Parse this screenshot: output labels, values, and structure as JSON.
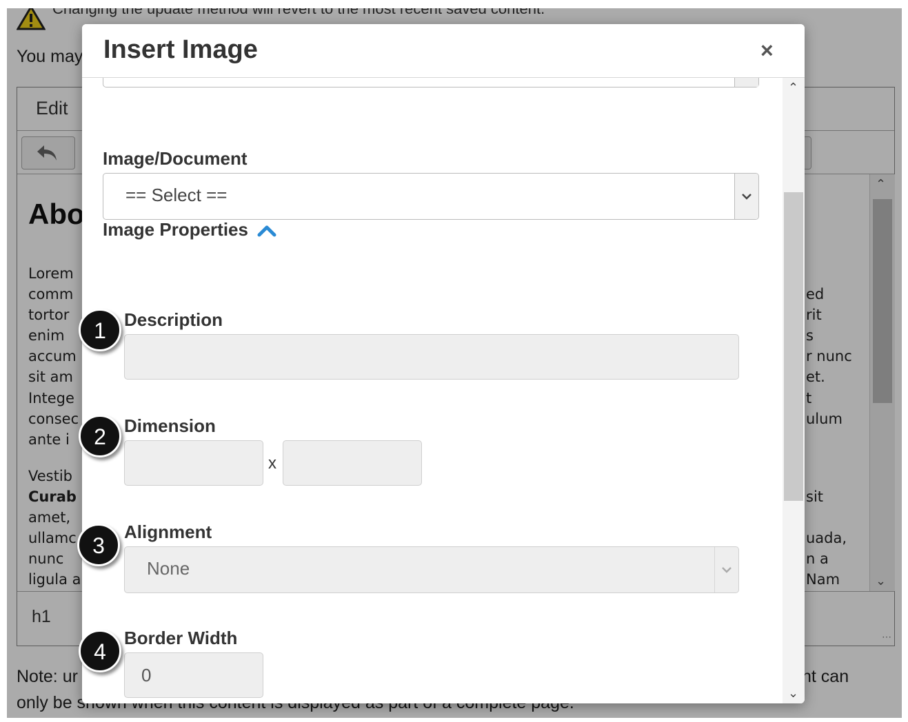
{
  "background": {
    "warning_text": "Changing the update method will revert to the most recent saved content.",
    "you_may_text": "You may",
    "edit_menu_label": "Edit",
    "content_heading": "Abo",
    "content_left_lines": [
      "Lorem",
      "comm",
      "tortor",
      "enim",
      "accum",
      "sit am",
      "Intege",
      "consec",
      "ante i",
      "",
      "Vestib",
      "Curab",
      "amet,",
      "ullamc",
      "nunc",
      "ligula a"
    ],
    "content_right_lines": [
      "ed",
      "rit",
      "s",
      "r nunc",
      "et.",
      "t",
      "ulum",
      "",
      "sit",
      "uada,",
      "n a",
      "Nam"
    ],
    "path_label": "h1",
    "note_left": "Note: ur",
    "note_right": "nt can",
    "note_line2": "only be shown when this content is displayed as part of a complete page."
  },
  "modal": {
    "title": "Insert Image",
    "close_symbol": "×",
    "image_document": {
      "label": "Image/Document",
      "selected": "== Select =="
    },
    "image_properties": {
      "label": "Image Properties"
    },
    "description": {
      "label": "Description",
      "value": ""
    },
    "dimension": {
      "label": "Dimension",
      "width": "",
      "height": "",
      "separator": "x"
    },
    "alignment": {
      "label": "Alignment",
      "selected": "None"
    },
    "border_width": {
      "label": "Border Width",
      "value": "0"
    }
  },
  "callouts": [
    "1",
    "2",
    "3",
    "4"
  ],
  "colors": {
    "accent_chevron": "#2a8ad4",
    "callout_bg": "#111111"
  }
}
